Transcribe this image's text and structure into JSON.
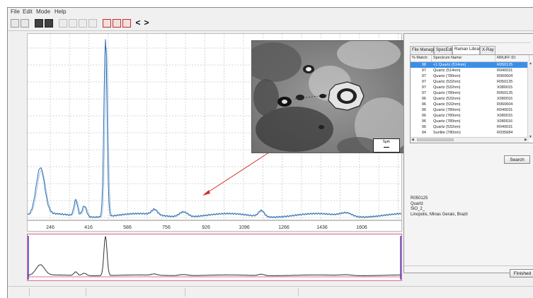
{
  "menu": [
    "File",
    "Edit",
    "Mode",
    "Help"
  ],
  "toolbar_icons": [
    "open-spectrum-icon",
    "open-multiple-icon",
    "save-icon",
    "print-icon",
    "zoom-in-icon",
    "zoom-out-icon",
    "zoom-reset-icon",
    "cut-icon",
    "baseline-icon",
    "peak-pick-icon",
    "smooth-icon",
    "previous-icon",
    "next-icon"
  ],
  "nav": {
    "prev": "<",
    "next": ">"
  },
  "spectrum": {
    "x_ticks": [
      "246",
      "416",
      "586",
      "756",
      "926",
      "1096",
      "1266",
      "1436",
      "1606"
    ],
    "colors": {
      "measured": "#2d6fb0",
      "reference": "#a9c4e0",
      "overview": "#333333",
      "arrow": "#d23030"
    }
  },
  "inset": {
    "scale_label": "5μm"
  },
  "right_panel": {
    "tabs": [
      "File Manager",
      "SpecEdit",
      "Raman Library",
      "X-Ray"
    ],
    "active_tab": "Raman Library",
    "columns": [
      "% Match:",
      "Spectrum Name:",
      "RRUFF ID:"
    ],
    "rows": [
      {
        "match": "98",
        "name": "<1 Quartz (514nm)",
        "id": "R050125"
      },
      {
        "match": "97",
        "name": "Quartz (514nm)",
        "id": "R040031"
      },
      {
        "match": "97",
        "name": "Quartz (780nm)",
        "id": "R060604"
      },
      {
        "match": "97",
        "name": "Quartz (532nm)",
        "id": "R050125"
      },
      {
        "match": "97",
        "name": "Quartz (532nm)",
        "id": "X080015"
      },
      {
        "match": "97",
        "name": "Quartz (780nm)",
        "id": "R050125"
      },
      {
        "match": "96",
        "name": "Quartz (532nm)",
        "id": "X080016"
      },
      {
        "match": "96",
        "name": "Quartz (532nm)",
        "id": "R060604"
      },
      {
        "match": "96",
        "name": "Quartz (780nm)",
        "id": "R040031"
      },
      {
        "match": "96",
        "name": "Quartz (780nm)",
        "id": "X080015"
      },
      {
        "match": "96",
        "name": "Quartz (780nm)",
        "id": "X080016"
      },
      {
        "match": "96",
        "name": "Quartz (532nm)",
        "id": "R040031"
      },
      {
        "match": "94",
        "name": "Sunlite (780nm)",
        "id": "R035684"
      }
    ],
    "search_label": "Search",
    "info": [
      "R050125",
      "Quartz",
      "SiO_2_",
      "Linopolis, Minas Gerais, Brazil"
    ],
    "finished_label": "Finished"
  }
}
